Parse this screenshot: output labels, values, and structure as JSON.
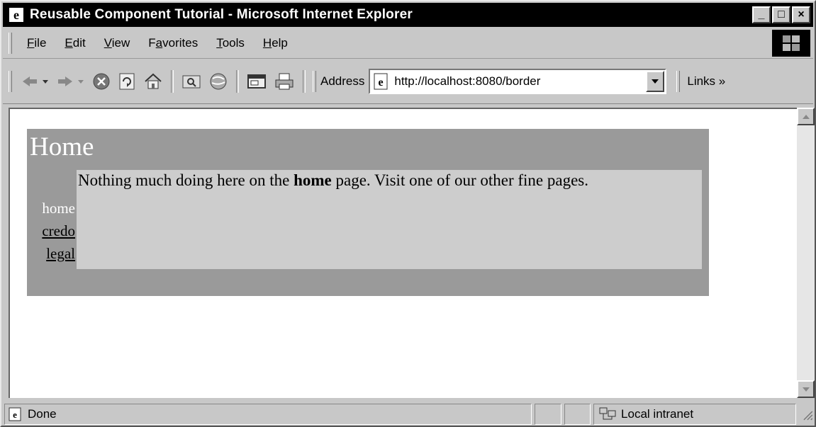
{
  "window": {
    "title": "Reusable Component Tutorial - Microsoft Internet Explorer",
    "minimize_label": "_",
    "maximize_label": "□",
    "close_label": "×"
  },
  "menu": {
    "items": [
      {
        "underline": "F",
        "rest": "ile"
      },
      {
        "underline": "E",
        "rest": "dit"
      },
      {
        "underline": "V",
        "rest": "iew"
      },
      {
        "pre": "F",
        "underline": "a",
        "rest": "vorites"
      },
      {
        "underline": "T",
        "rest": "ools"
      },
      {
        "underline": "H",
        "rest": "elp"
      }
    ]
  },
  "toolbar": {
    "address_label": "Address",
    "address_value": "http://localhost:8080/border",
    "links_label": "Links »",
    "icons": [
      "back-icon",
      "forward-icon",
      "stop-icon",
      "refresh-icon",
      "home-icon",
      "search-icon",
      "history-icon",
      "mail-icon",
      "print-icon"
    ]
  },
  "page": {
    "title": "Home",
    "nav": {
      "current": "home",
      "links": [
        "credo",
        "legal"
      ]
    },
    "content": {
      "before": "Nothing much doing here on the ",
      "bold": "home",
      "after": " page. Visit one of our other fine pages."
    }
  },
  "status": {
    "text": "Done",
    "zone": "Local intranet"
  },
  "colors": {
    "titlebar": "#000000",
    "chrome": "#c8c8c8",
    "border_table": "#9a9a9a",
    "content_cell": "#cdcdcd"
  }
}
